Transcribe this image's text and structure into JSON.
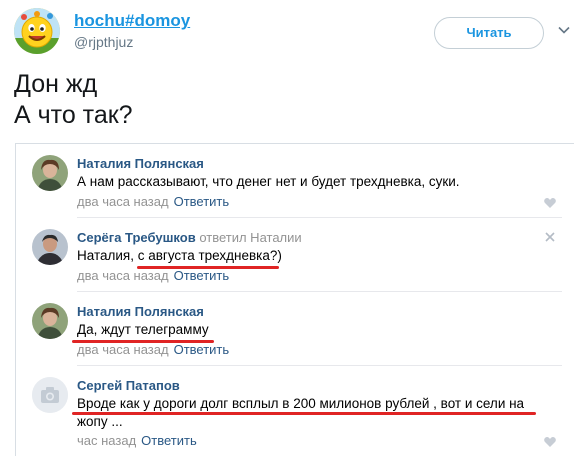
{
  "tweet": {
    "display_name": "hochu#domoy",
    "screen_name": "@rjpthjuz",
    "follow_label": "Читать",
    "text_lines": [
      "Дон жд",
      "А что так?"
    ]
  },
  "comments": [
    {
      "author": "Наталия Полянская",
      "text_lines": [
        "А нам рассказывают, что денег нет и будет трехдневка, суки."
      ],
      "time": "два часа назад",
      "reply_label": "Ответить"
    },
    {
      "author": "Серёга Требушков",
      "replied": "ответил Наталии",
      "text_lines": [
        "Наталия, с августа трехдневка?)"
      ],
      "time": "два часа назад",
      "reply_label": "Ответить"
    },
    {
      "author": "Наталия Полянская",
      "text_lines": [
        "Да, ждут телеграмму"
      ],
      "time": "два часа назад",
      "reply_label": "Ответить"
    },
    {
      "author": "Сергей Патапов",
      "text_lines": [
        "Вроде как у дороги долг всплыл в 200 милионов рублей , вот и сели на",
        "жопу ..."
      ],
      "time": "час назад",
      "reply_label": "Ответить"
    }
  ],
  "icons": {
    "more": "chevron-down-icon",
    "like": "heart-icon",
    "delete": "close-icon",
    "no_photo": "camera-icon"
  },
  "colors": {
    "tweet_link": "#1b95e0",
    "vk_link": "#2a5885",
    "muted": "#939393",
    "highlight": "#e02424"
  }
}
